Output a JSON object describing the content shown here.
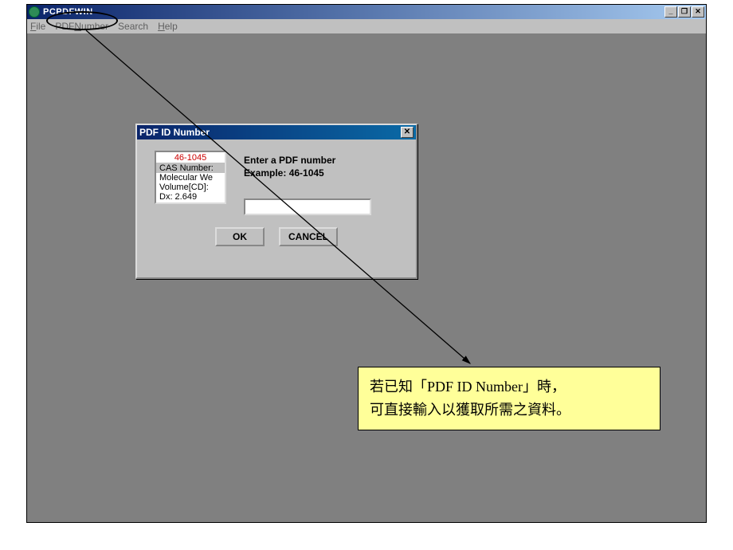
{
  "app": {
    "title": "PCPDFWIN"
  },
  "menu": {
    "file": "File",
    "pdfnumber": "PDFNumber",
    "search": "Search",
    "help": "Help"
  },
  "window_controls": {
    "minimize": "_",
    "maximize": "❐",
    "close": "✕"
  },
  "dialog": {
    "title": "PDF ID Number",
    "close": "✕",
    "instruction_line1": "Enter a PDF number",
    "instruction_line2": "Example:  46-1045",
    "input_value": "",
    "list": {
      "header": "46-1045",
      "items": [
        "CAS Number:",
        "Molecular We",
        "Volume[CD]:",
        "Dx:  2.649"
      ]
    },
    "ok": "OK",
    "cancel": "CANCEL"
  },
  "callout": {
    "line1": "若已知「PDF ID Number」時，",
    "line2": "可直接輸入以獲取所需之資料。"
  }
}
